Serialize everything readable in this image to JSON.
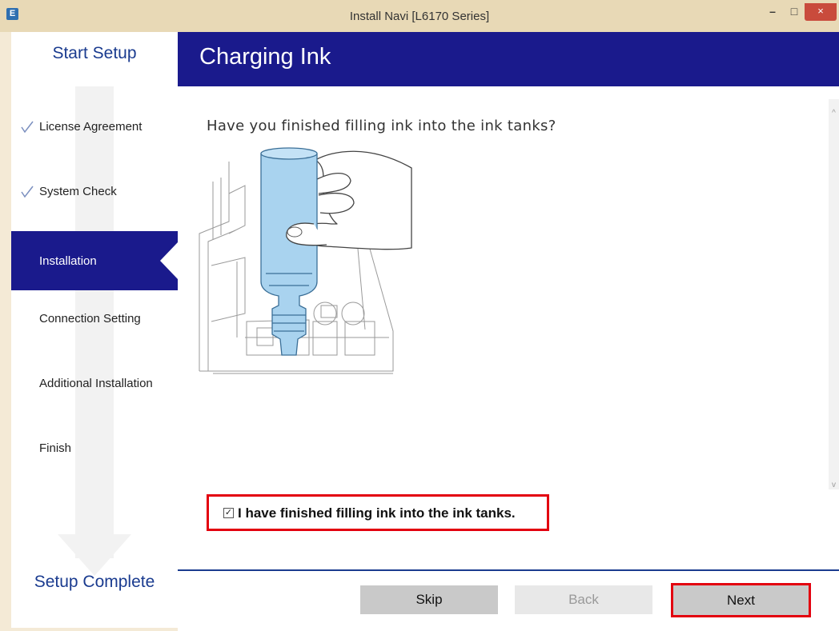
{
  "window": {
    "title": "Install Navi [L6170 Series]",
    "app_icon": "E",
    "controls": {
      "minimize": "–",
      "maximize": "□",
      "close": "×"
    }
  },
  "sidebar": {
    "start_title": "Start Setup",
    "end_title": "Setup Complete",
    "steps": [
      {
        "label": "License Agreement",
        "completed": true
      },
      {
        "label": "System Check",
        "completed": true
      },
      {
        "label": "Installation",
        "active": true
      },
      {
        "label": "Connection Setting"
      },
      {
        "label": "Additional Installation"
      },
      {
        "label": "Finish"
      }
    ],
    "check_mark": "✓"
  },
  "page": {
    "title": "Charging Ink",
    "question": "Have you finished filling ink into the ink tanks?",
    "confirm": {
      "checked": true,
      "checkbox_glyph": "✓",
      "label": "I have finished filling ink into the ink tanks."
    },
    "scroll_up": "^",
    "scroll_down": "v"
  },
  "buttons": {
    "skip": "Skip",
    "back": "Back",
    "next": "Next"
  },
  "colors": {
    "brand_blue": "#1a1a8c",
    "highlight_red": "#e3000f",
    "ink_bottle": "#a9d3ef"
  }
}
